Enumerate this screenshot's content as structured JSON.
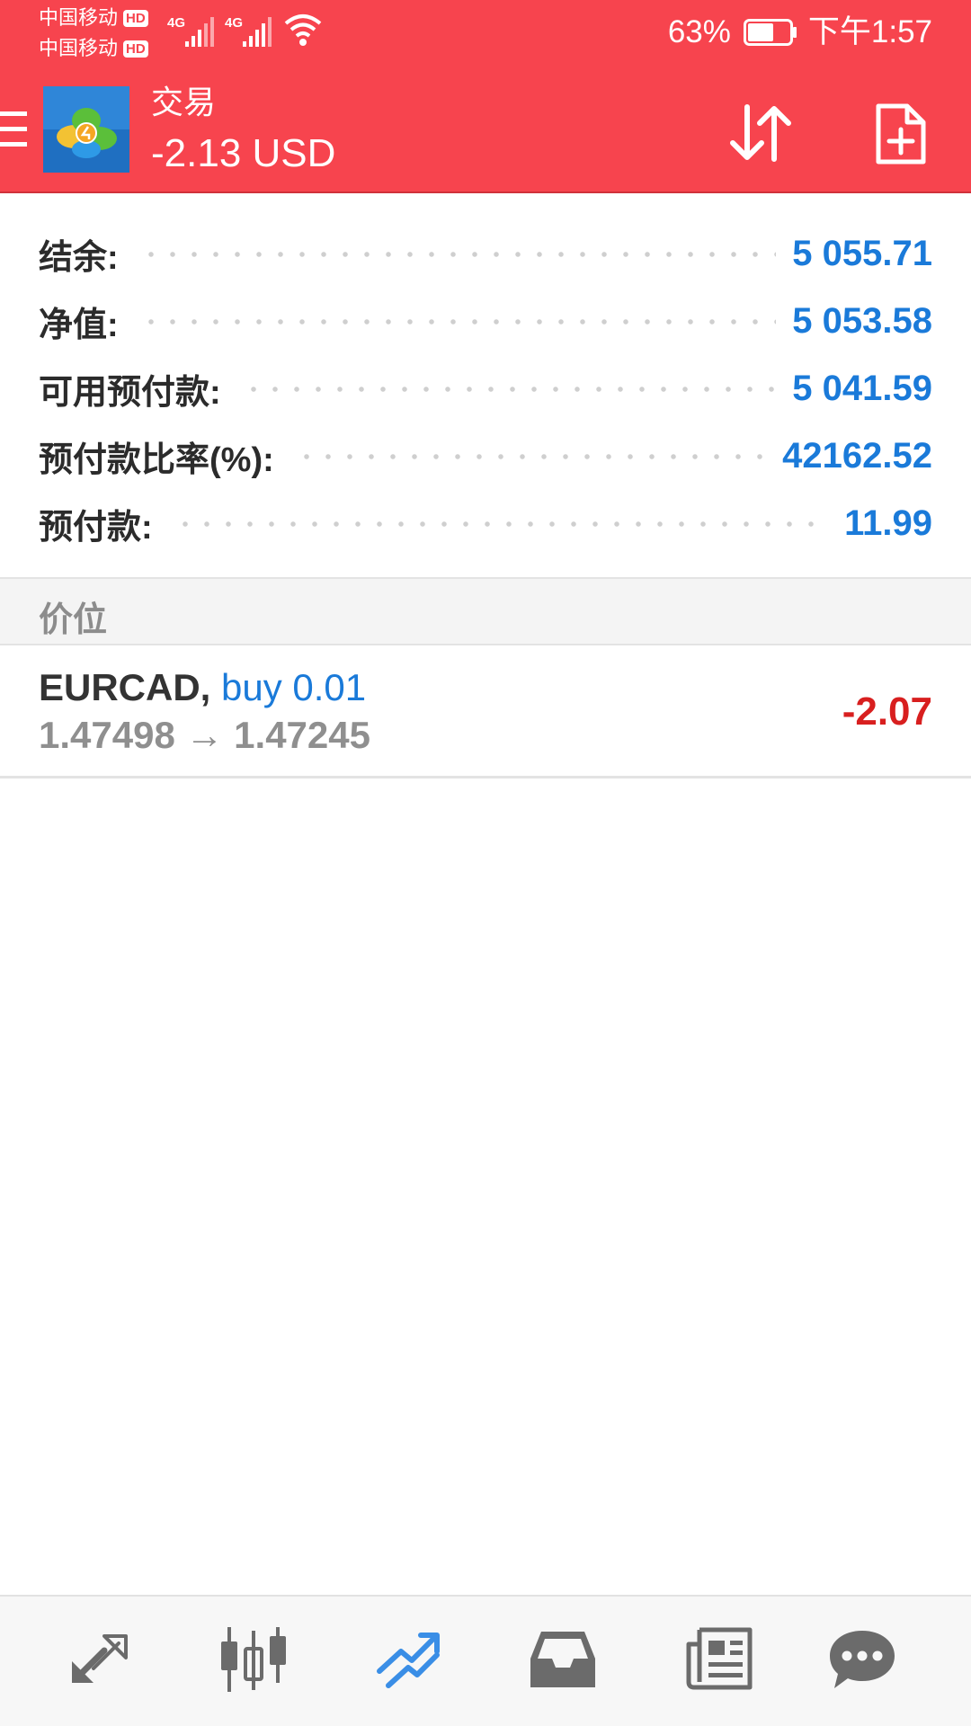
{
  "status_bar": {
    "carrier1": "中国移动",
    "carrier2": "中国移动",
    "hd_badge": "HD",
    "network": "4G",
    "battery_percent": "63%",
    "battery_level": 0.63,
    "time": "下午1:57"
  },
  "app_bar": {
    "title": "交易",
    "profit": "-2.13 USD",
    "icons": {
      "menu": "hamburger-icon",
      "logo": "metatrader-logo",
      "sort": "sort-arrows-icon",
      "new_order": "new-order-document-icon"
    }
  },
  "summary": [
    {
      "label": "结余:",
      "value": "5 055.71"
    },
    {
      "label": "净值:",
      "value": "5 053.58"
    },
    {
      "label": "可用预付款:",
      "value": "5 041.59"
    },
    {
      "label": "预付款比率(%):",
      "value": "42162.52"
    },
    {
      "label": "预付款:",
      "value": "11.99"
    }
  ],
  "section": {
    "title": "价位"
  },
  "positions": [
    {
      "symbol": "EURCAD,",
      "side": "buy 0.01",
      "open_price": "1.47498",
      "arrow": "→",
      "current_price": "1.47245",
      "profit": "-2.07"
    }
  ],
  "bottom_nav": {
    "active": "trade",
    "items": [
      "quotes-icon",
      "chart-icon",
      "trade-icon",
      "history-icon",
      "news-icon",
      "chat-icon"
    ]
  },
  "colors": {
    "header": "#f7444e",
    "accent_blue": "#1a7ad9",
    "loss_red": "#d81f1f",
    "nav_icon": "#6b6b6b",
    "nav_active": "#3a8ee6"
  }
}
